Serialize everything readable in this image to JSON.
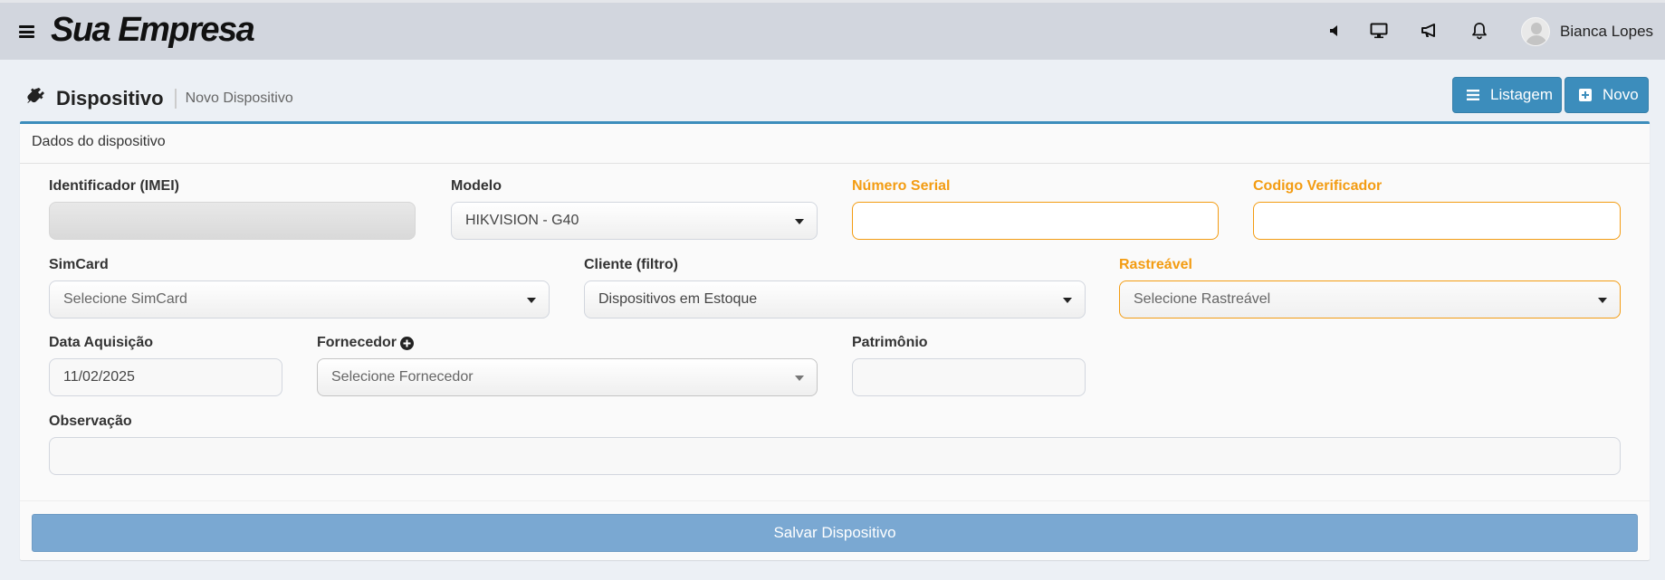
{
  "header": {
    "brand": "Sua Empresa",
    "icons": [
      "volume-icon",
      "monitor-icon",
      "megaphone-icon",
      "bell-icon"
    ],
    "user_name": "Bianca Lopes"
  },
  "content_header": {
    "title": "Dispositivo",
    "subtitle": "Novo Dispositivo",
    "list_button": "Listagem",
    "new_button": "Novo"
  },
  "form": {
    "box_title": "Dados do dispositivo",
    "imei": {
      "label": "Identificador (IMEI)",
      "value": ""
    },
    "modelo": {
      "label": "Modelo",
      "value": "HIKVISION - G40"
    },
    "numero_serial": {
      "label": "Número Serial",
      "value": ""
    },
    "codigo_verificador": {
      "label": "Codigo Verificador",
      "value": ""
    },
    "simcard": {
      "label": "SimCard",
      "placeholder": "Selecione SimCard"
    },
    "cliente": {
      "label": "Cliente (filtro)",
      "value": "Dispositivos em Estoque"
    },
    "rastreavel": {
      "label": "Rastreável",
      "placeholder": "Selecione Rastreável"
    },
    "data_aquisicao": {
      "label": "Data Aquisição",
      "value": "11/02/2025"
    },
    "fornecedor": {
      "label": "Fornecedor",
      "placeholder": "Selecione Fornecedor"
    },
    "patrimonio": {
      "label": "Patrimônio",
      "value": ""
    },
    "observacao": {
      "label": "Observação",
      "value": ""
    },
    "save_button": "Salvar Dispositivo"
  },
  "colors": {
    "primary": "#3c8dbc",
    "warning": "#f39c12",
    "save_button": "#7aa8d2"
  }
}
